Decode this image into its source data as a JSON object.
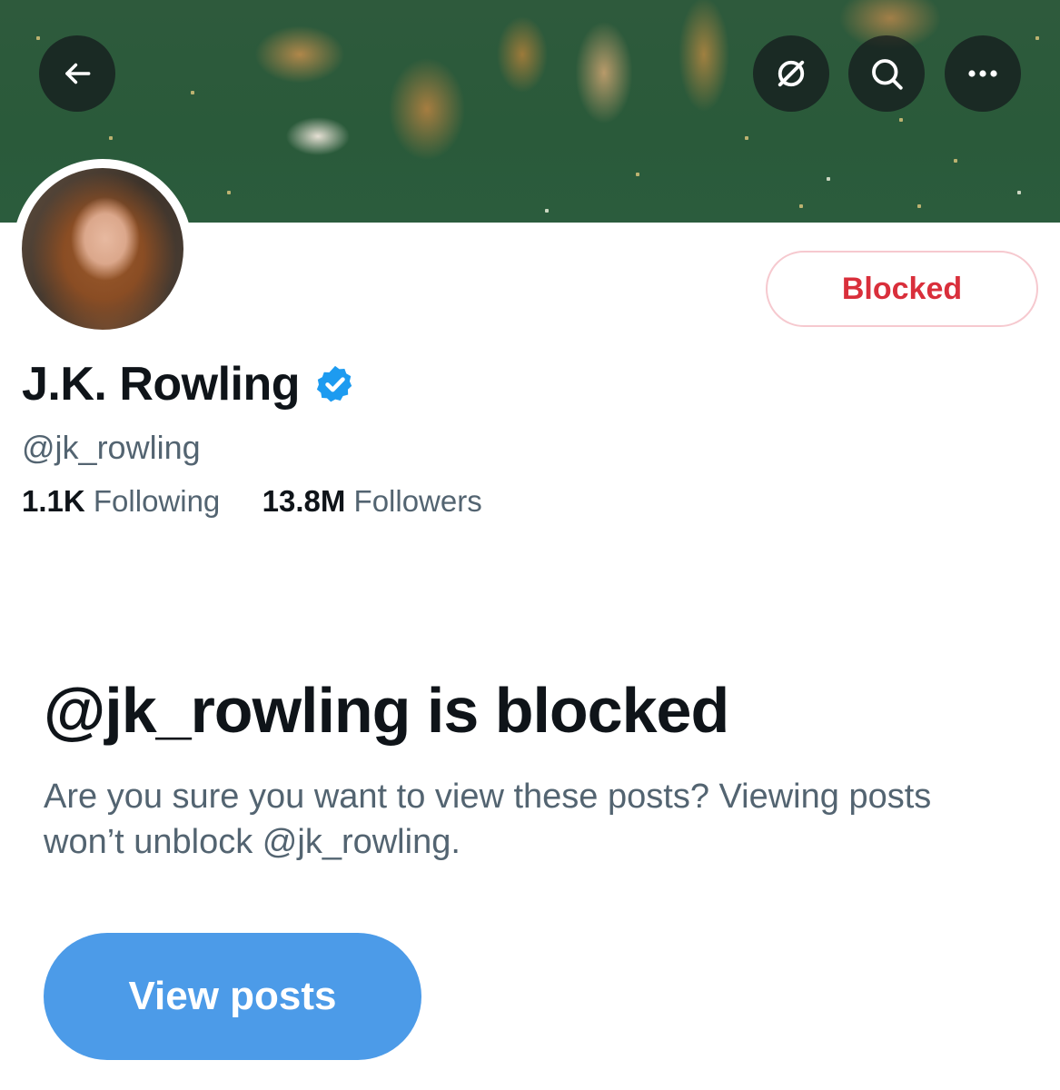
{
  "header": {
    "back_icon": "arrow-left-icon",
    "grok_icon": "grok-icon",
    "search_icon": "search-icon",
    "more_icon": "more-horizontal-icon"
  },
  "profile": {
    "block_button_label": "Blocked",
    "display_name": "J.K. Rowling",
    "verified_icon": "verified-badge-icon",
    "handle": "@jk_rowling",
    "following_count": "1.1K",
    "following_label": "Following",
    "followers_count": "13.8M",
    "followers_label": "Followers"
  },
  "blocked_notice": {
    "title": "@jk_rowling is blocked",
    "description": "Are you sure you want to view these posts? Viewing posts won’t unblock @jk_rowling.",
    "view_posts_label": "View posts"
  },
  "colors": {
    "block_red": "#d92f3b",
    "verified_blue": "#1d9bf0",
    "button_blue": "#4c9be8",
    "secondary_text": "#536471"
  }
}
